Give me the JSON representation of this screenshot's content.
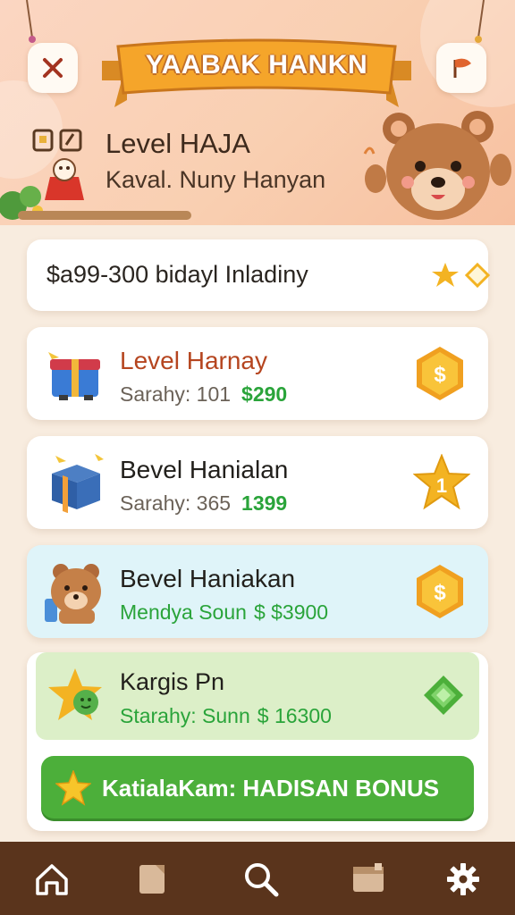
{
  "header": {
    "banner_title": "YAABAK HANKN",
    "level_title": "Level HAJA",
    "level_subtitle": "Kaval. Nuny Hanyan"
  },
  "rows": [
    {
      "title": "$a99-300 bidayl Inladiny"
    },
    {
      "title": "Level Harnay",
      "sub_label": "Sarahy: 101",
      "amount": "$290"
    },
    {
      "title": "Bevel Hanialan",
      "sub_label": "Sarahy: 365",
      "amount": "1399"
    },
    {
      "title": "Bevel Haniakan",
      "sub_label": "Mendya Soun",
      "amount": "$ $3900"
    },
    {
      "title": "Kargis Pn",
      "sub_label": "Starahy: Sunn",
      "amount": "$ 16300"
    }
  ],
  "badges": {
    "coin_symbol": "$",
    "star_number": "1"
  },
  "bonus_button": {
    "label": "KatialaKam: HADISAN BONUS"
  },
  "nav": [
    "home",
    "notes",
    "search",
    "inventory",
    "settings"
  ],
  "colors": {
    "accent_green": "#4caf3a",
    "banner_orange": "#f5a52a",
    "nav_brown": "#5a341c",
    "title_red": "#b5451f"
  }
}
